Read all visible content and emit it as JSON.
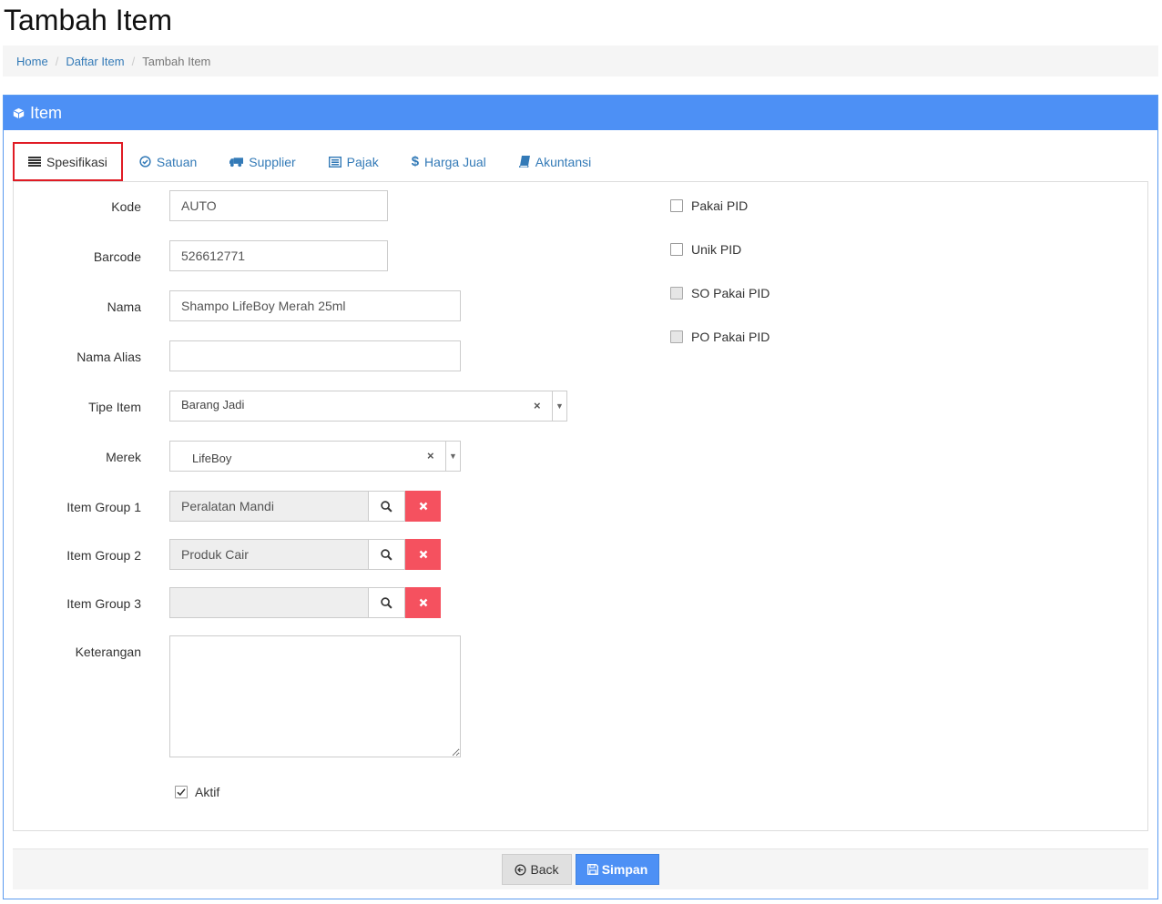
{
  "page": {
    "title": "Tambah Item"
  },
  "breadcrumb": {
    "home": "Home",
    "list": "Daftar Item",
    "current": "Tambah Item"
  },
  "panel": {
    "title": "Item"
  },
  "tabs": [
    {
      "label": "Spesifikasi",
      "icon": "list-icon"
    },
    {
      "label": "Satuan",
      "icon": "check-circle-icon"
    },
    {
      "label": "Supplier",
      "icon": "truck-icon"
    },
    {
      "label": "Pajak",
      "icon": "list-alt-icon"
    },
    {
      "label": "Harga Jual",
      "icon": "dollar-icon"
    },
    {
      "label": "Akuntansi",
      "icon": "book-icon"
    }
  ],
  "form": {
    "kode": {
      "label": "Kode",
      "value": "AUTO"
    },
    "barcode": {
      "label": "Barcode",
      "value": "526612771"
    },
    "nama": {
      "label": "Nama",
      "value": "Shampo LifeBoy Merah 25ml"
    },
    "nama_alias": {
      "label": "Nama Alias",
      "value": ""
    },
    "tipe_item": {
      "label": "Tipe Item",
      "value": "Barang Jadi"
    },
    "merek": {
      "label": "Merek",
      "value": "LifeBoy"
    },
    "item_group_1": {
      "label": "Item Group 1",
      "value": "Peralatan Mandi"
    },
    "item_group_2": {
      "label": "Item Group 2",
      "value": "Produk Cair"
    },
    "item_group_3": {
      "label": "Item Group 3",
      "value": ""
    },
    "keterangan": {
      "label": "Keterangan",
      "value": ""
    },
    "aktif": {
      "label": "Aktif",
      "checked": true
    }
  },
  "checkboxes": {
    "pakai_pid": {
      "label": "Pakai PID",
      "checked": false
    },
    "unik_pid": {
      "label": "Unik PID",
      "checked": false
    },
    "so_pakai_pid": {
      "label": "SO Pakai PID",
      "checked": false,
      "disabled": true
    },
    "po_pakai_pid": {
      "label": "PO Pakai PID",
      "checked": false,
      "disabled": true
    }
  },
  "buttons": {
    "back": "Back",
    "save": "Simpan"
  },
  "colors": {
    "primary": "#4d90f5",
    "danger": "#f5515f",
    "highlight": "#e01b24",
    "link": "#337ab7"
  }
}
